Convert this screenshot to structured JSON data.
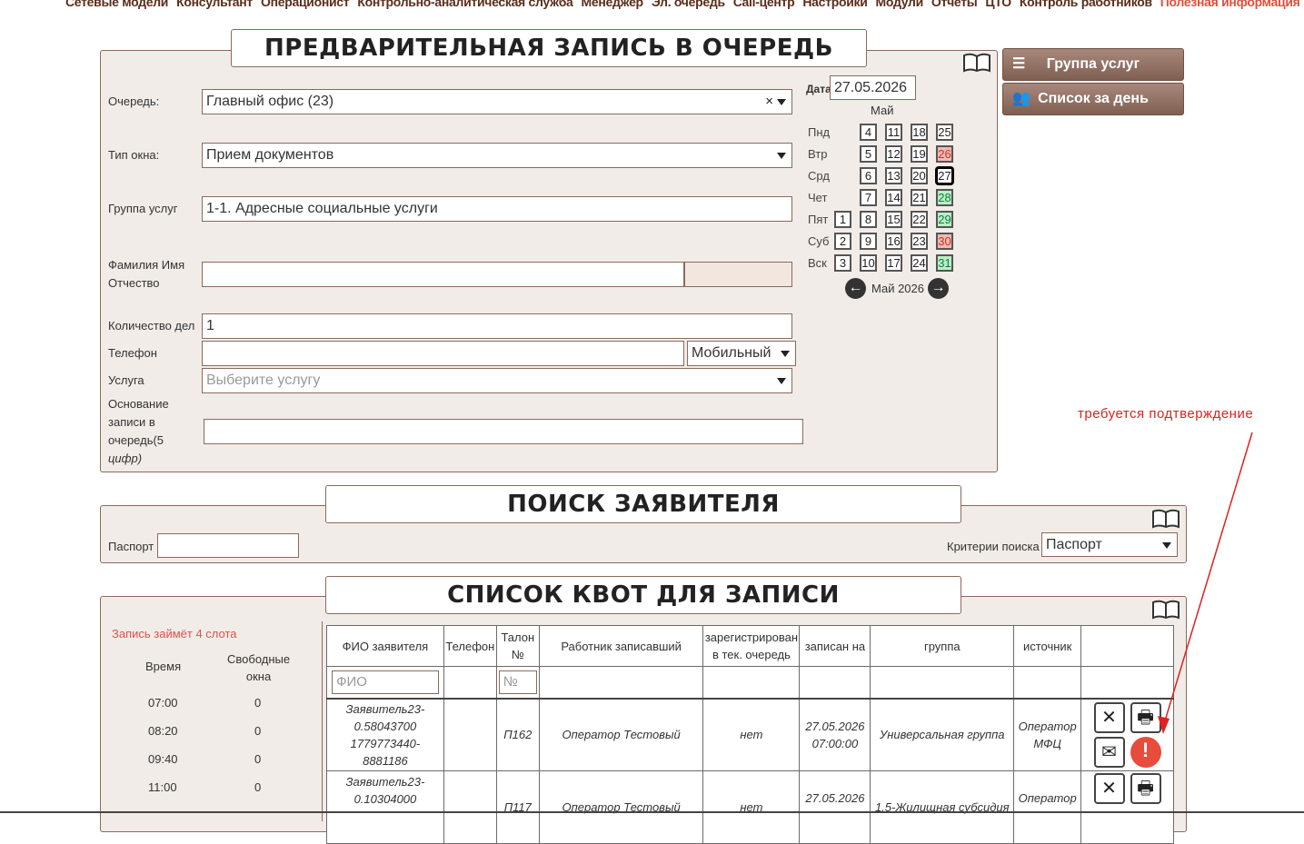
{
  "topnav": [
    "Сетевые модели",
    "Консультант",
    "Операционист",
    "Контрольно-аналитическая служба",
    "Менеджер",
    "Эл. очередь",
    "Call-центр",
    "Настройки",
    "Модули",
    "Отчеты",
    "ЦТО",
    "Контроль работников",
    "Полезная информация"
  ],
  "booking": {
    "title": "ПРЕДВАРИТЕЛЬНАЯ ЗАПИСЬ В ОЧЕРЕДЬ",
    "queue_label": "Очередь:",
    "queue_value": "Главный офис (23)",
    "window_type_label": "Тип окна:",
    "window_type_value": "Прием документов",
    "service_group_label": "Группа услуг",
    "service_group_value": "1-1. Адресные социальные услуги",
    "fio_label_1": "Фамилия Имя",
    "fio_label_2": "Отчество",
    "cases_label": "Количество дел",
    "cases_value": "1",
    "phone_label": "Телефон",
    "phone_type": "Мобильный",
    "service_label": "Услуга",
    "service_placeholder": "Выберите услугу",
    "basis_label_1": "Основание",
    "basis_label_2": "записи в",
    "basis_label_3": "очередь(5",
    "basis_label_4": "цифр)"
  },
  "calendar": {
    "date_label": "Дата",
    "date_value": "27.05.2026",
    "month_header": "Май",
    "month_footer": "Май 2026",
    "weekdays": [
      "Пнд",
      "Втр",
      "Срд",
      "Чет",
      "Пят",
      "Суб",
      "Вск"
    ]
  },
  "side_buttons": {
    "groups": "Группа услуг",
    "day_list": "Список за день"
  },
  "search": {
    "title": "ПОИСК ЗАЯВИТЕЛЯ",
    "passport_label": "Паспорт",
    "criteria_label": "Критерии поиска",
    "criteria_value": "Паспорт"
  },
  "quotas": {
    "title": "СПИСОК КВОТ ДЛЯ ЗАПИСИ",
    "slot_note": "Запись займёт 4 слота",
    "time_header": "Время",
    "free_header_1": "Свободные",
    "free_header_2": "окна",
    "slots": [
      {
        "time": "07:00",
        "free": "0"
      },
      {
        "time": "08:20",
        "free": "0"
      },
      {
        "time": "09:40",
        "free": "0"
      },
      {
        "time": "11:00",
        "free": "0"
      }
    ],
    "columns": {
      "fio": "ФИО заявителя",
      "phone": "Телефон",
      "ticket_1": "Талон",
      "ticket_2": "№",
      "worker": "Работник записавший",
      "registered_1": "зарегистрирован",
      "registered_2": "в тек. очередь",
      "booked_for": "записан на",
      "group": "группа",
      "source": "источник"
    },
    "filter_fio": "ФИО",
    "filter_ticket": "№",
    "rows": [
      {
        "fio_1": "Заявитель23-",
        "fio_2": "0.58043700",
        "fio_3": "1779773440-",
        "fio_4": "8881186",
        "ticket": "П162",
        "worker": "Оператор Тестовый",
        "registered": "нет",
        "date": "27.05.2026",
        "time": "07:00:00",
        "group": "Универсальная группа",
        "source_1": "Оператор",
        "source_2": "МФЦ"
      },
      {
        "fio_1": "Заявитель23-",
        "fio_2": "0.10304000",
        "ticket": "П117",
        "worker": "Оператор Тестовый",
        "registered": "нет",
        "date": "27.05.2026",
        "group": "1.5-Жилищная субсидия",
        "source_1": "Оператор"
      }
    ]
  },
  "annotation": "требуется подтверждение"
}
